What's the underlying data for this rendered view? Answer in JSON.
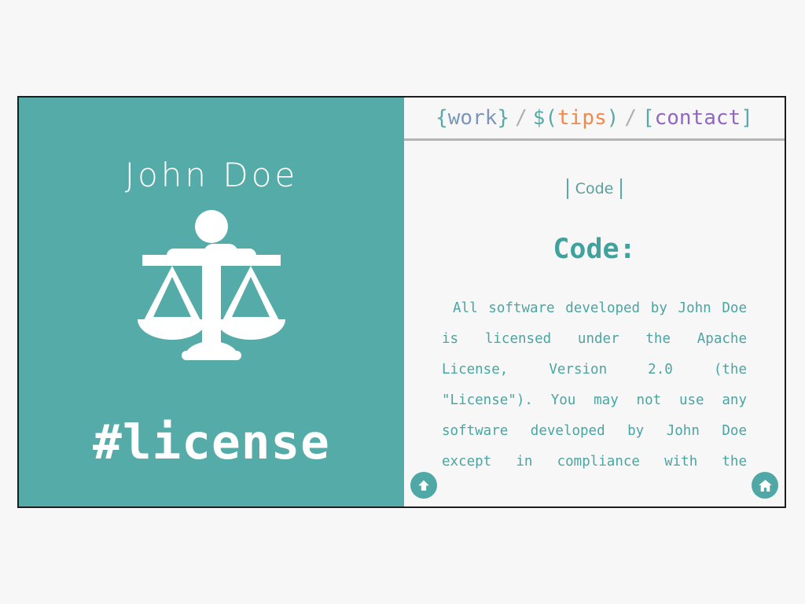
{
  "profile": {
    "name": "John Doe",
    "handle": "#license",
    "emblem_icon": "balance-scales-icon",
    "background_color": "#55aba8"
  },
  "nav": {
    "items": [
      {
        "open": "{",
        "label": "work",
        "close": "}",
        "color": "#7a96b8"
      },
      {
        "open": "$(",
        "label": "tips",
        "close": ")",
        "color": "#f08a4b"
      },
      {
        "open": "[",
        "label": "contact",
        "close": "]",
        "color": "#9068be"
      }
    ],
    "separator": "/",
    "bracket_color": "#55aba8",
    "separator_color": "#b0b0b0"
  },
  "content": {
    "page_tag": "Code",
    "section_title": "Code:",
    "license_body": "All software developed by John Doe is licensed under the Apache License, Version 2.0 (the \"License\"). You may not use any software developed by John Doe except in compliance with the",
    "text_color": "#4aa5a2"
  },
  "controls": {
    "scroll_top": {
      "icon": "arrow-up-icon",
      "label": "Scroll to top"
    },
    "home": {
      "icon": "home-icon",
      "label": "Home"
    },
    "accent_color": "#4fa8a5"
  }
}
